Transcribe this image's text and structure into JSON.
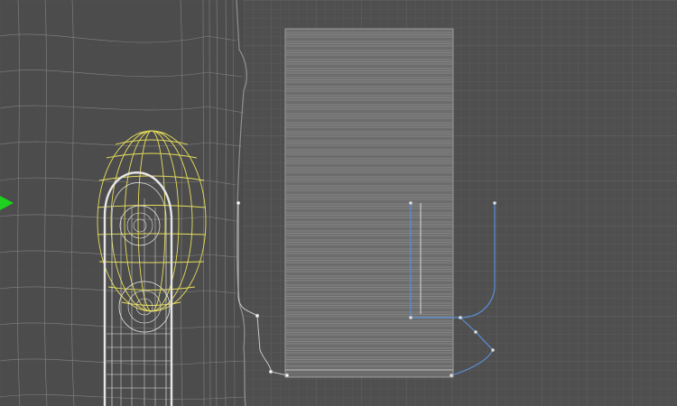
{
  "viewport": {
    "background": "#4f4f4f",
    "grid_minor_color": "#5c5c5c",
    "grid_major_color": "#646464",
    "wireframe_color": "#8a8a8a",
    "mesh_white_color": "#e6e6e6",
    "selection_color": "#e8df5a",
    "curve_color": "#5a8fd8",
    "axis_marker_color": "#1fd11f",
    "objects": [
      {
        "name": "background-wireframe-mesh",
        "kind": "polygon mesh"
      },
      {
        "name": "selected-sphere-mesh",
        "kind": "polygon mesh",
        "selected": true
      },
      {
        "name": "capsule-mesh",
        "kind": "polygon mesh"
      },
      {
        "name": "striped-panel-mesh",
        "kind": "polygon mesh"
      },
      {
        "name": "profile-curve",
        "kind": "bezier curve"
      },
      {
        "name": "nurbs-curve",
        "kind": "nurbs curve"
      }
    ]
  }
}
